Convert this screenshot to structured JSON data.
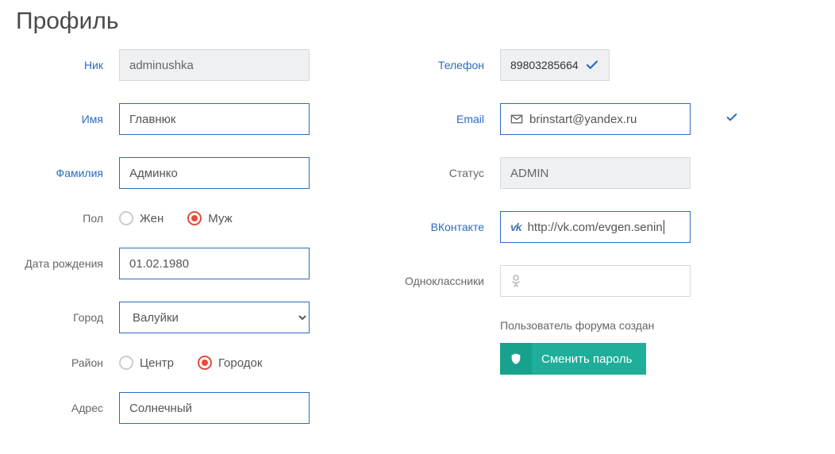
{
  "title": "Профиль",
  "left": {
    "nick_label": "Ник",
    "nick_value": "adminushka",
    "name_label": "Имя",
    "name_value": "Главнюк",
    "lastname_label": "Фамилия",
    "lastname_value": "Админко",
    "gender_label": "Пол",
    "gender_female": "Жен",
    "gender_male": "Муж",
    "gender_value": "male",
    "dob_label": "Дата рождения",
    "dob_value": "01.02.1980",
    "city_label": "Город",
    "city_value": "Валуйки",
    "district_label": "Район",
    "district_center": "Центр",
    "district_gorodok": "Городок",
    "district_value": "gorodok",
    "address_label": "Адрес",
    "address_value": "Солнечный"
  },
  "right": {
    "phone_label": "Телефон",
    "phone_value": "89803285664",
    "email_label": "Email",
    "email_value": "brinstart@yandex.ru",
    "status_label": "Статус",
    "status_value": "ADMIN",
    "vk_label": "ВКонтакте",
    "vk_value": "http://vk.com/evgen.senin",
    "ok_label": "Одноклассники",
    "ok_value": "",
    "forum_note": "Пользователь форума создан",
    "change_password": "Сменить пароль"
  }
}
